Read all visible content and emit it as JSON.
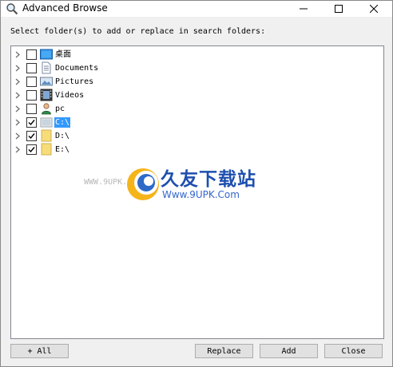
{
  "window": {
    "title": "Advanced Browse"
  },
  "prompt": "Select folder(s) to add or replace in search folders:",
  "tree": {
    "items": [
      {
        "label": "桌面",
        "checked": false,
        "icon": "desktop-icon",
        "selected": false
      },
      {
        "label": "Documents",
        "checked": false,
        "icon": "documents-icon",
        "selected": false
      },
      {
        "label": "Pictures",
        "checked": false,
        "icon": "pictures-icon",
        "selected": false
      },
      {
        "label": "Videos",
        "checked": false,
        "icon": "videos-icon",
        "selected": false
      },
      {
        "label": "pc",
        "checked": false,
        "icon": "user-icon",
        "selected": false
      },
      {
        "label": "C:\\",
        "checked": true,
        "icon": "drive-icon",
        "selected": true
      },
      {
        "label": "D:\\",
        "checked": true,
        "icon": "folder-icon",
        "selected": false
      },
      {
        "label": "E:\\",
        "checked": true,
        "icon": "folder-icon",
        "selected": false
      }
    ]
  },
  "buttons": {
    "add_all": "+ All",
    "replace": "Replace",
    "add": "Add",
    "close": "Close"
  },
  "watermark": {
    "left_text": "WWW.9UPK.COM",
    "title": "久友下载站",
    "url": "Www.9UPK.Com"
  },
  "colors": {
    "selection": "#3399ff",
    "folder": "#f5d76e",
    "button_face": "#e1e1e1"
  }
}
